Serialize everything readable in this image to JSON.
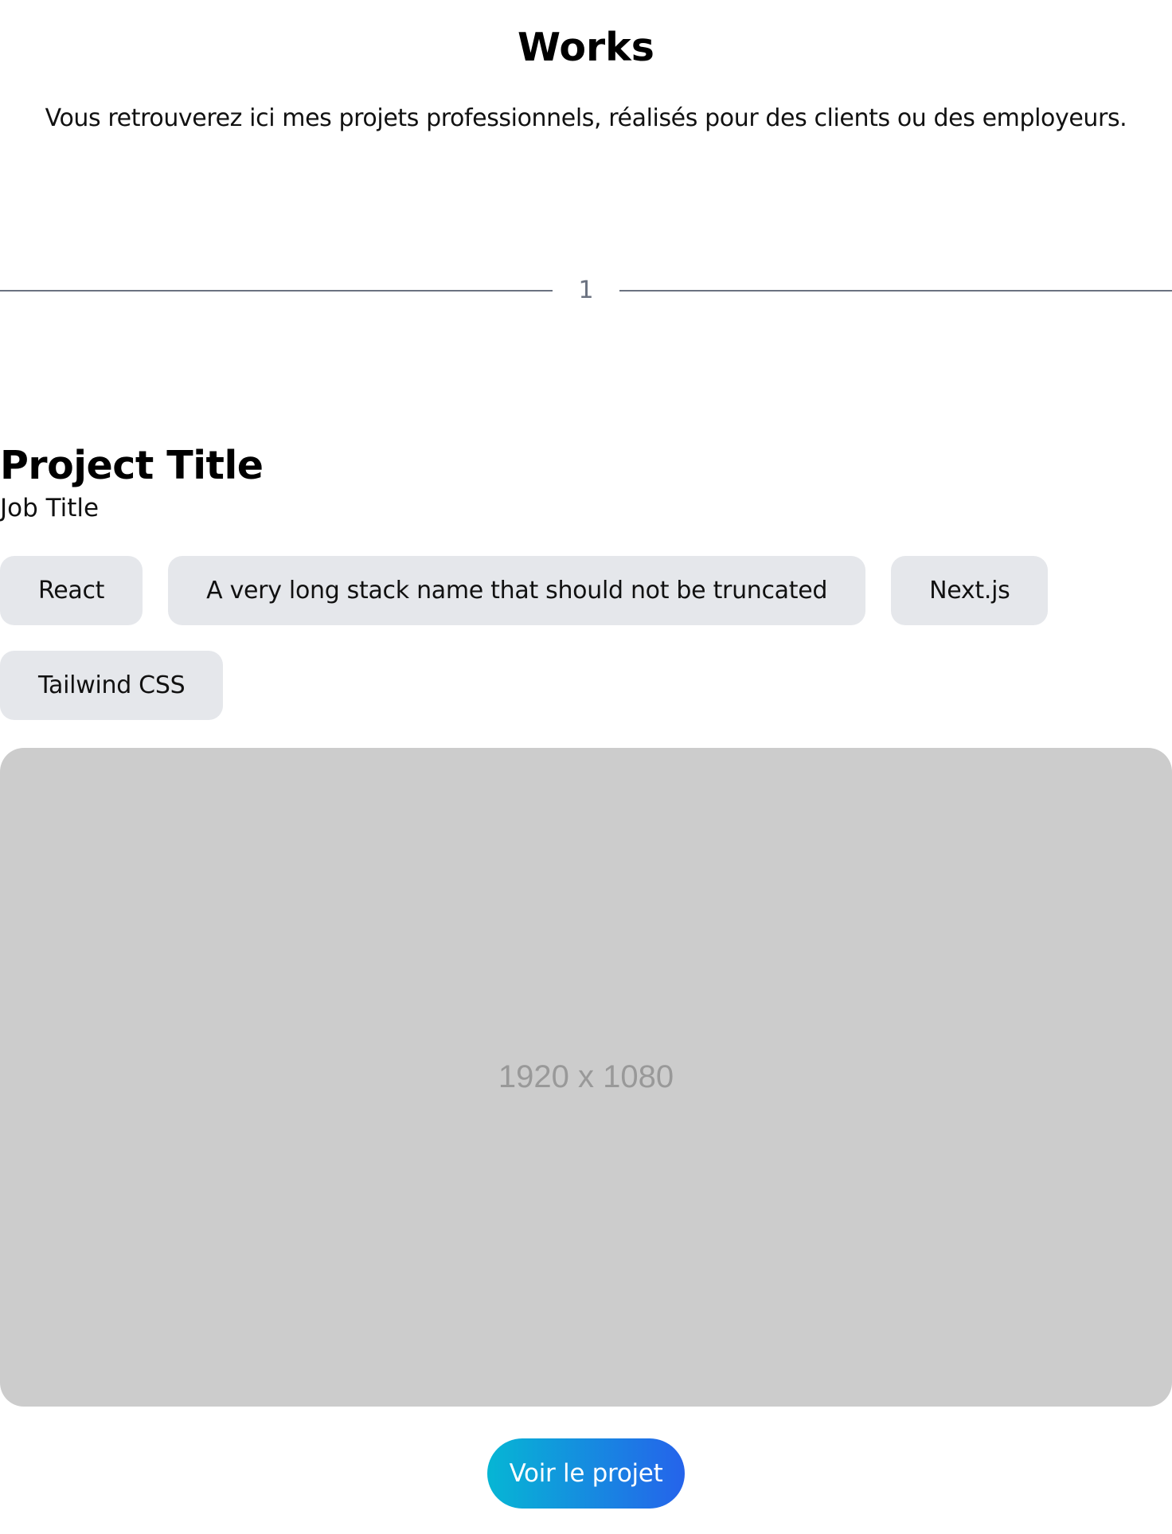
{
  "header": {
    "title": "Works",
    "intro": "Vous retrouverez ici mes projets professionnels, réalisés pour des clients ou des employeurs."
  },
  "divider": {
    "number": "1"
  },
  "project": {
    "title": "Project Title",
    "job_title": "Job Title",
    "stack": [
      "React",
      "A very long stack name that should not be truncated",
      "Next.js",
      "Tailwind CSS"
    ],
    "image_placeholder": "1920 x 1080",
    "cta_label": "Voir le projet"
  },
  "colors": {
    "tag_background": "#e5e7eb",
    "placeholder_background": "#cccccc",
    "cta_gradient_start": "#06b6d4",
    "cta_gradient_end": "#2563eb",
    "divider": "#6b7280"
  }
}
